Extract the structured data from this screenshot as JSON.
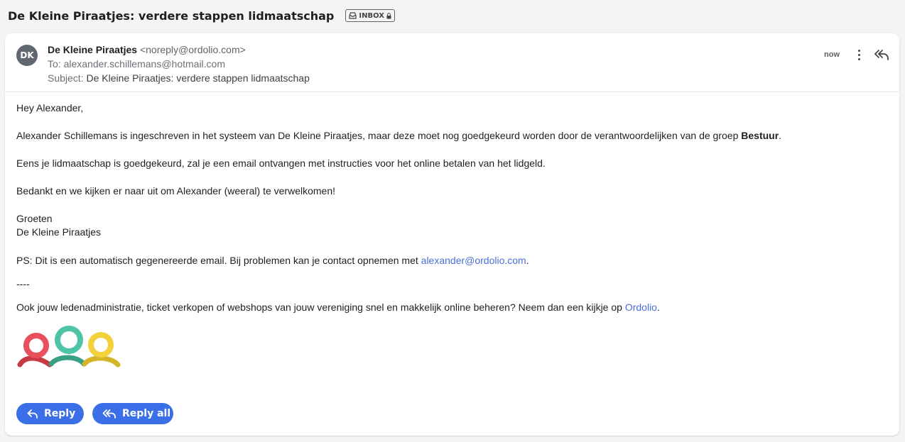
{
  "email": {
    "title": "De Kleine Piraatjes: verdere stappen lidmaatschap",
    "badge": "INBOX",
    "sender": {
      "initials": "DK",
      "name": "De Kleine Piraatjes",
      "email": "<noreply@ordolio.com>"
    },
    "to_label": "To:",
    "to": "alexander.schillemans@hotmail.com",
    "subject_label": "Subject:",
    "subject": "De Kleine Piraatjes: verdere stappen lidmaatschap",
    "time": "now"
  },
  "body": {
    "greeting": "Hey Alexander,",
    "p1_text": "Alexander Schillemans is ingeschreven in het systeem van De Kleine Piraatjes, maar deze moet nog goedgekeurd worden door de verantwoordelijken van de groep ",
    "p1_bold": "Bestuur",
    "p1_end": ".",
    "p2": "Eens je lidmaatschap is goedgekeurd, zal je een email ontvangen met instructies voor het online betalen van het lidgeld.",
    "p3": "Bedankt en we kijken er naar uit om Alexander (weeral) te verwelkomen!",
    "sign1": "Groeten",
    "sign2": "De Kleine Piraatjes",
    "ps_text": "PS: Dit is een automatisch gegenereerde email. Bij problemen kan je contact opnemen met ",
    "ps_link": "alexander@ordolio.com",
    "ps_end": ".",
    "divider": "----",
    "promo_text": "Ook jouw ledenadministratie, ticket verkopen of webshops van jouw vereniging snel en makkelijk online beheren? Neem dan een kijkje op ",
    "promo_link": "Ordolio",
    "promo_end": "."
  },
  "actions": {
    "reply": "Reply",
    "reply_all": "Reply all"
  },
  "colors": {
    "accent": "#3b6fe8",
    "link": "#4a6fd8",
    "logo_red": "#e8505b",
    "logo_green": "#4ec3a6",
    "logo_yellow": "#f2d13a"
  }
}
